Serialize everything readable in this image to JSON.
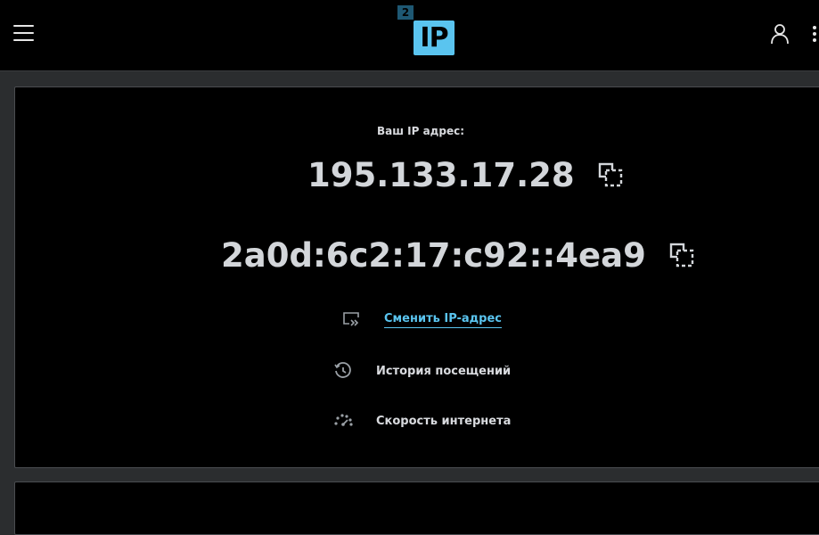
{
  "header": {
    "logo_badge": "2",
    "logo_main": "IP"
  },
  "main": {
    "ip_label": "Ваш IP адрес:",
    "ipv4": "195.133.17.28",
    "ipv6": "2a0d:6c2:17:c92::4ea9",
    "actions": {
      "change_ip": "Сменить IP-адрес",
      "history": "История посещений",
      "speed": "Скорость интернета"
    }
  },
  "colors": {
    "accent": "#5ac4ef",
    "background": "#000000",
    "text": "#d9dbdf"
  },
  "icons": {
    "menu": "hamburger-menu-icon",
    "user": "user-icon",
    "apps": "apps-grid-icon",
    "copy": "copy-icon",
    "change_ip": "switch-ip-icon",
    "history": "history-clock-icon",
    "speed": "speedometer-icon"
  }
}
